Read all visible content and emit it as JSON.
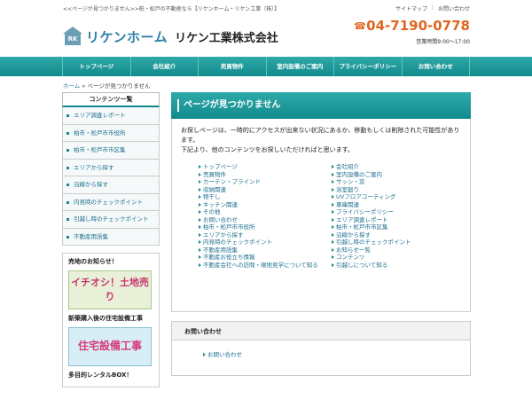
{
  "topbar": {
    "tagline": "<<ページが見つかりません>>柏・松戸の不動産なら【リケンホーム・リケン工業（株）】",
    "links": [
      "サイトマップ",
      "お問い合わせ"
    ]
  },
  "header": {
    "logo_mark": "RK",
    "logo_text": "リケンホーム",
    "company": "リケン工業株式会社",
    "phone": "04-7190-0778",
    "hours": "営業時間9:00～17:00"
  },
  "nav": [
    "トップページ",
    "会社紹介",
    "売買物件",
    "室内設備のご案内",
    "プライバシーポリシー",
    "お問い合わせ"
  ],
  "breadcrumb": {
    "home": "ホーム",
    "sep": "»",
    "current": "ページが見つかりません"
  },
  "sidebar": {
    "title": "コンテンツ一覧",
    "items": [
      "エリア調査レポート",
      "柏市・松戸市市役所",
      "柏市・松戸市市区集",
      "エリアから探す",
      "沿線から探す",
      "内見時のチェックポイント",
      "引越し時のチェックポイント",
      "不動産用語集"
    ],
    "notice_title": "売地のお知らせ！",
    "banner1": "イチオシ！土地売り",
    "caption1": "新築購入後の住宅設備工事",
    "banner2": "住宅設備工事",
    "caption2": "多目的レンタルBOX！"
  },
  "main": {
    "title": "ページが見つかりません",
    "message": [
      "お探しページは、一時的にアクセスが出来ない状況にあるか、移動もしくは削除された可能性があります。",
      "下記より、他のコンテンツをお探しいただければと思います。"
    ],
    "links_left": [
      "トップページ",
      "売買物件",
      "カーテン・ブラインド",
      "収納関連",
      "物干し",
      "キッチン関連",
      "その他",
      "お問い合わせ",
      "柏市・松戸市市役所",
      "エリアから探す",
      "内見時のチェックポイント",
      "不動産用語集",
      "不動産お役立ち情報",
      "不動産会社への訪問・現地見学について知る"
    ],
    "links_right": [
      "会社紹介",
      "室内設備のご案内",
      "サッシ・窓",
      "浴室廻り",
      "UVフロアコーティング",
      "車庫関連",
      "プライバシーポリシー",
      "エリア調査レポート",
      "柏市・松戸市市区集",
      "沿線から探す",
      "引越し時のチェックポイント",
      "お知らせ一覧",
      "コンテンツ",
      "引越しについて知る"
    ],
    "contact_title": "お問い合わせ",
    "contact_link": "お問い合わせ"
  }
}
